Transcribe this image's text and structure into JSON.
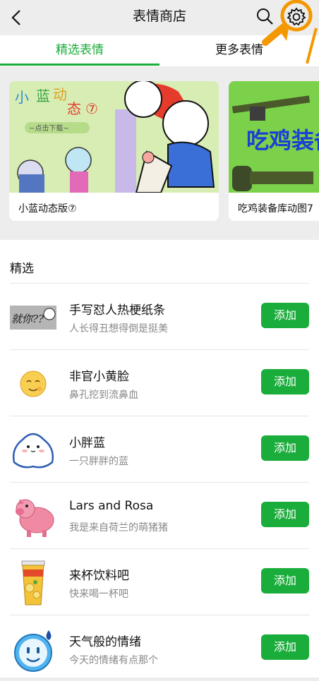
{
  "nav": {
    "title": "表情商店"
  },
  "tabs": {
    "selected": "精选表情",
    "more": "更多表情"
  },
  "banner": [
    {
      "label": "小蓝动态版⑦",
      "art_text": [
        "小",
        "蓝",
        "动",
        "态",
        "⑦"
      ],
      "art_sub": "~点击下载~"
    },
    {
      "label": "吃鸡装备库动图7",
      "art_text": "吃鸡装备"
    }
  ],
  "section": {
    "title": "精选"
  },
  "items": [
    {
      "name": "手写怼人热梗纸条",
      "desc": "人长得丑想得倒是挺美",
      "button": "添加",
      "icon": "handwritten-note-icon"
    },
    {
      "name": "非官小黄脸",
      "desc": "鼻孔挖到流鼻血",
      "button": "添加",
      "icon": "yellow-face-icon"
    },
    {
      "name": "小胖蓝",
      "desc": "一只胖胖的蓝",
      "button": "添加",
      "icon": "chubby-blue-icon"
    },
    {
      "name": "Lars and Rosa",
      "desc": "我是来自荷兰的萌猪猪",
      "button": "添加",
      "icon": "pink-pig-icon"
    },
    {
      "name": "来杯饮料吧",
      "desc": "快来喝一杯吧",
      "button": "添加",
      "icon": "drink-cup-icon"
    },
    {
      "name": "天气般的情绪",
      "desc": "今天的情绪有点那个",
      "button": "添加",
      "icon": "blue-weather-face-icon"
    }
  ],
  "colors": {
    "accent": "#1aad3b",
    "annotation": "#f39800"
  }
}
